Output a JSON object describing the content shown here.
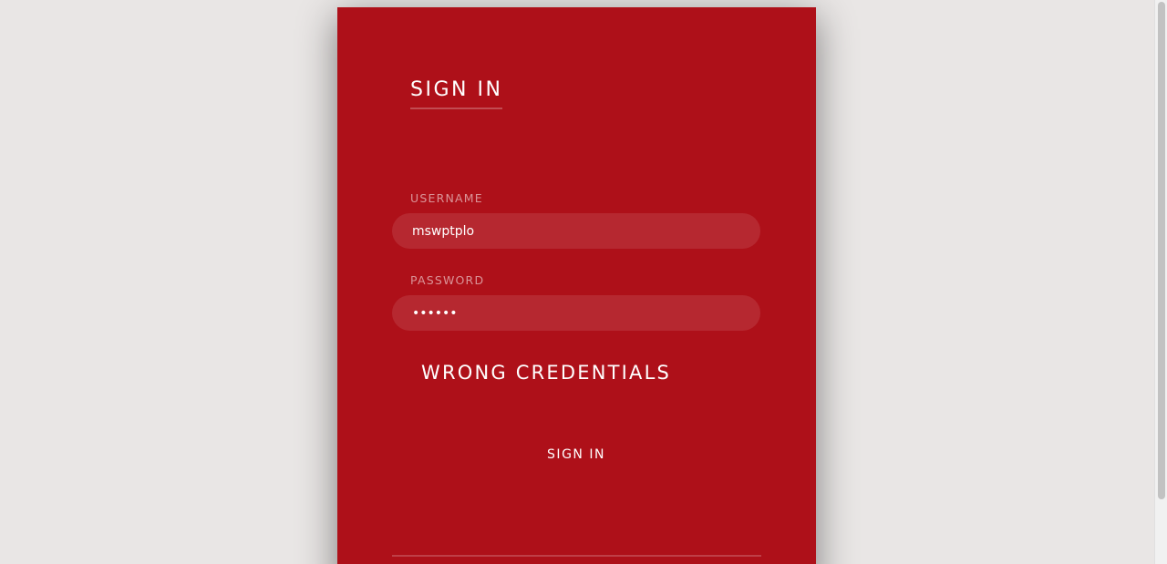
{
  "login": {
    "tab_label": "SIGN IN",
    "username_label": "USERNAME",
    "username_value": "mswptplo",
    "password_label": "PASSWORD",
    "password_value": "••••••",
    "error_message": "WRONG CREDENTIALS",
    "submit_label": "SIGN IN"
  },
  "colors": {
    "card_background": "#ae1019",
    "page_background": "#e9e6e5",
    "text": "#ffffff"
  }
}
